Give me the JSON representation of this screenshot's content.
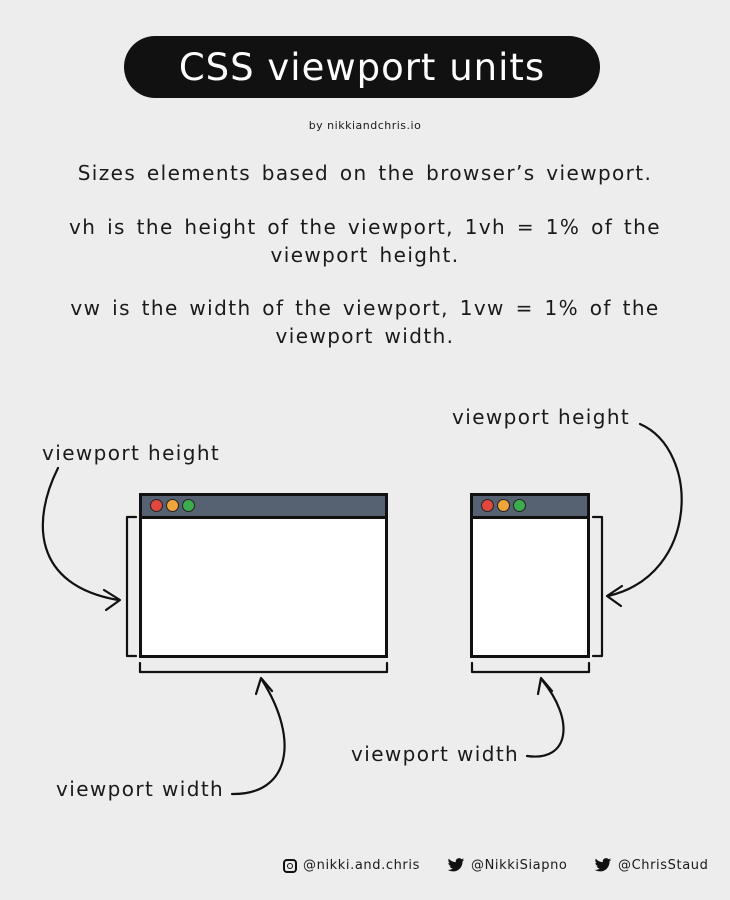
{
  "header": {
    "title": "CSS viewport units",
    "byline": "by nikkiandchris.io"
  },
  "intro": {
    "line1": "Sizes elements based on the browser’s viewport.",
    "vh_def": "vh is the height of the viewport, 1vh = 1% of the viewport height.",
    "vw_def": "vw is the width of the viewport, 1vw = 1% of the viewport width."
  },
  "diagram": {
    "left": {
      "height_label": "viewport height",
      "width_label": "viewport width"
    },
    "right": {
      "height_label": "viewport height",
      "width_label": "viewport width"
    },
    "window_bar_color": "#566171",
    "dot_colors": [
      "#e0483e",
      "#f0a53a",
      "#3cad4e"
    ]
  },
  "footer": {
    "instagram": "@nikki.and.chris",
    "twitter1": "@NikkiSiapno",
    "twitter2": "@ChrisStaud"
  }
}
